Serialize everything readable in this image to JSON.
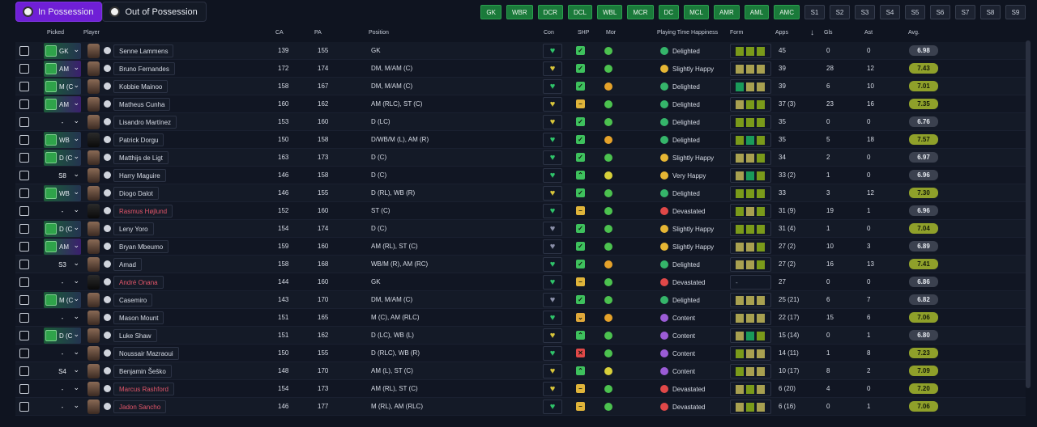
{
  "tabs": [
    {
      "label": "In Possession",
      "active": true
    },
    {
      "label": "Out of Possession",
      "active": false
    }
  ],
  "filters": [
    {
      "label": "GK",
      "active": true
    },
    {
      "label": "WBR",
      "active": true
    },
    {
      "label": "DCR",
      "active": true
    },
    {
      "label": "DCL",
      "active": true
    },
    {
      "label": "WBL",
      "active": true
    },
    {
      "label": "MCR",
      "active": true
    },
    {
      "label": "DC",
      "active": true
    },
    {
      "label": "MCL",
      "active": true
    },
    {
      "label": "AMR",
      "active": true
    },
    {
      "label": "AML",
      "active": true
    },
    {
      "label": "AMC",
      "active": true
    },
    {
      "label": "S1",
      "active": false
    },
    {
      "label": "S2",
      "active": false
    },
    {
      "label": "S3",
      "active": false
    },
    {
      "label": "S4",
      "active": false
    },
    {
      "label": "S5",
      "active": false
    },
    {
      "label": "S6",
      "active": false
    },
    {
      "label": "S7",
      "active": false
    },
    {
      "label": "S8",
      "active": false
    },
    {
      "label": "S9",
      "active": false
    }
  ],
  "columns": {
    "picked": "Picked",
    "player": "Player",
    "ca": "CA",
    "pa": "PA",
    "position": "Position",
    "con": "Con",
    "shp": "SHP",
    "mor": "Mor",
    "happiness": "Playing Time Happiness",
    "form": "Form",
    "apps": "Apps",
    "sort_arrow": "↓",
    "gls": "Gls",
    "ast": "Ast",
    "avg": "Avg."
  },
  "colors": {
    "accent": "#6f1fd6",
    "filter_green": "#1a7a3a",
    "rating_high": "#8fa02a",
    "rating_low": "#3b414f",
    "red_name": "#e2566a"
  },
  "players": [
    {
      "picked": "GK",
      "picked_style": "g",
      "name": "Senne Lammens",
      "red": false,
      "silhouette": false,
      "ca": "139",
      "pa": "155",
      "position": "GK",
      "con": "green",
      "shp": "check",
      "mor": "green",
      "happiness": "Delighted",
      "happy_color": "green",
      "form": [
        "#7a9a1a",
        "#7a9a1a",
        "#7a9a1a"
      ],
      "apps": "45",
      "gls": "0",
      "ast": "0",
      "avg": "6.98",
      "avg_high": false
    },
    {
      "picked": "AM",
      "picked_style": "p",
      "name": "Bruno Fernandes",
      "red": false,
      "silhouette": false,
      "ca": "172",
      "pa": "174",
      "position": "DM, M/AM (C)",
      "con": "yellow",
      "shp": "check",
      "mor": "green",
      "happiness": "Slightly Happy",
      "happy_color": "yellow",
      "form": [
        "#a8a050",
        "#a8a050",
        "#a8a050"
      ],
      "apps": "39",
      "gls": "28",
      "ast": "12",
      "avg": "7.43",
      "avg_high": true
    },
    {
      "picked": "M (C",
      "picked_style": "g",
      "name": "Kobbie Mainoo",
      "red": false,
      "silhouette": false,
      "ca": "158",
      "pa": "167",
      "position": "DM, M/AM (C)",
      "con": "green",
      "shp": "check",
      "mor": "orange",
      "happiness": "Delighted",
      "happy_color": "green",
      "form": [
        "#1a9a5a",
        "#a8a050",
        "#a8a050"
      ],
      "apps": "39",
      "gls": "6",
      "ast": "10",
      "avg": "7.01",
      "avg_high": true
    },
    {
      "picked": "AM",
      "picked_style": "p",
      "name": "Matheus Cunha",
      "red": false,
      "silhouette": false,
      "ca": "160",
      "pa": "162",
      "position": "AM (RLC), ST (C)",
      "con": "yellow",
      "shp": "dash",
      "mor": "green",
      "happiness": "Delighted",
      "happy_color": "green",
      "form": [
        "#a8a050",
        "#7a9a1a",
        "#7a9a1a"
      ],
      "apps": "37 (3)",
      "gls": "23",
      "ast": "16",
      "avg": "7.35",
      "avg_high": true
    },
    {
      "picked": "-",
      "picked_style": "n",
      "name": "Lisandro Martínez",
      "red": false,
      "silhouette": false,
      "ca": "153",
      "pa": "160",
      "position": "D (LC)",
      "con": "yellow",
      "shp": "check",
      "mor": "green",
      "happiness": "Delighted",
      "happy_color": "green",
      "form": [
        "#7a9a1a",
        "#7a9a1a",
        "#7a9a1a"
      ],
      "apps": "35",
      "gls": "0",
      "ast": "0",
      "avg": "6.76",
      "avg_high": false
    },
    {
      "picked": "WB",
      "picked_style": "g",
      "name": "Patrick Dorgu",
      "red": false,
      "silhouette": true,
      "ca": "150",
      "pa": "158",
      "position": "D/WB/M (L), AM (R)",
      "con": "green",
      "shp": "check",
      "mor": "orange",
      "happiness": "Delighted",
      "happy_color": "green",
      "form": [
        "#7a9a1a",
        "#1a9a5a",
        "#7a9a1a"
      ],
      "apps": "35",
      "gls": "5",
      "ast": "18",
      "avg": "7.57",
      "avg_high": true
    },
    {
      "picked": "D (C",
      "picked_style": "g",
      "name": "Matthijs de Ligt",
      "red": false,
      "silhouette": false,
      "ca": "163",
      "pa": "173",
      "position": "D (C)",
      "con": "green",
      "shp": "check",
      "mor": "green",
      "happiness": "Slightly Happy",
      "happy_color": "yellow",
      "form": [
        "#a8a050",
        "#a8a050",
        "#7a9a1a"
      ],
      "apps": "34",
      "gls": "2",
      "ast": "0",
      "avg": "6.97",
      "avg_high": false
    },
    {
      "picked": "S8",
      "picked_style": "n",
      "name": "Harry Maguire",
      "red": false,
      "silhouette": false,
      "ca": "146",
      "pa": "158",
      "position": "D (C)",
      "con": "green",
      "shp": "up",
      "mor": "yellow",
      "happiness": "Very Happy",
      "happy_color": "yellow",
      "form": [
        "#a8a050",
        "#1a9a5a",
        "#7a9a1a"
      ],
      "apps": "33 (2)",
      "gls": "1",
      "ast": "0",
      "avg": "6.96",
      "avg_high": false
    },
    {
      "picked": "WB",
      "picked_style": "g",
      "name": "Diogo Dalot",
      "red": false,
      "silhouette": false,
      "ca": "146",
      "pa": "155",
      "position": "D (RL), WB (R)",
      "con": "yellow",
      "shp": "check",
      "mor": "green",
      "happiness": "Delighted",
      "happy_color": "green",
      "form": [
        "#7a9a1a",
        "#7a9a1a",
        "#7a9a1a"
      ],
      "apps": "33",
      "gls": "3",
      "ast": "12",
      "avg": "7.30",
      "avg_high": true
    },
    {
      "picked": "-",
      "picked_style": "n",
      "name": "Rasmus Højlund",
      "red": true,
      "silhouette": true,
      "ca": "152",
      "pa": "160",
      "position": "ST (C)",
      "con": "green",
      "shp": "dash",
      "mor": "green",
      "happiness": "Devastated",
      "happy_color": "red",
      "form": [
        "#7a9a1a",
        "#a8a050",
        "#7a9a1a"
      ],
      "apps": "31 (9)",
      "gls": "19",
      "ast": "1",
      "avg": "6.96",
      "avg_high": false
    },
    {
      "picked": "D (C",
      "picked_style": "g",
      "name": "Leny Yoro",
      "red": false,
      "silhouette": false,
      "ca": "154",
      "pa": "174",
      "position": "D (C)",
      "con": "grey",
      "shp": "check",
      "mor": "green",
      "happiness": "Slightly Happy",
      "happy_color": "yellow",
      "form": [
        "#7a9a1a",
        "#7a9a1a",
        "#7a9a1a"
      ],
      "apps": "31 (4)",
      "gls": "1",
      "ast": "0",
      "avg": "7.04",
      "avg_high": true
    },
    {
      "picked": "AM",
      "picked_style": "p",
      "name": "Bryan Mbeumo",
      "red": false,
      "silhouette": false,
      "ca": "159",
      "pa": "160",
      "position": "AM (RL), ST (C)",
      "con": "grey",
      "shp": "check",
      "mor": "green",
      "happiness": "Slightly Happy",
      "happy_color": "yellow",
      "form": [
        "#a8a050",
        "#a8a050",
        "#7a9a1a"
      ],
      "apps": "27 (2)",
      "gls": "10",
      "ast": "3",
      "avg": "6.89",
      "avg_high": false
    },
    {
      "picked": "S3",
      "picked_style": "n",
      "name": "Amad",
      "red": false,
      "silhouette": false,
      "ca": "158",
      "pa": "168",
      "position": "WB/M (R), AM (RC)",
      "con": "green",
      "shp": "check",
      "mor": "orange",
      "happiness": "Delighted",
      "happy_color": "green",
      "form": [
        "#a8a050",
        "#a8a050",
        "#7a9a1a"
      ],
      "apps": "27 (2)",
      "gls": "16",
      "ast": "13",
      "avg": "7.41",
      "avg_high": true
    },
    {
      "picked": "-",
      "picked_style": "n",
      "name": "André Onana",
      "red": true,
      "silhouette": true,
      "ca": "144",
      "pa": "160",
      "position": "GK",
      "con": "green",
      "shp": "dash",
      "mor": "green",
      "happiness": "Devastated",
      "happy_color": "red",
      "form": [],
      "apps": "27",
      "gls": "0",
      "ast": "0",
      "avg": "6.86",
      "avg_high": false
    },
    {
      "picked": "M (C",
      "picked_style": "g",
      "name": "Casemiro",
      "red": false,
      "silhouette": false,
      "ca": "143",
      "pa": "170",
      "position": "DM, M/AM (C)",
      "con": "grey",
      "shp": "check",
      "mor": "green",
      "happiness": "Delighted",
      "happy_color": "green",
      "form": [
        "#a8a050",
        "#a8a050",
        "#a8a050"
      ],
      "apps": "25 (21)",
      "gls": "6",
      "ast": "7",
      "avg": "6.82",
      "avg_high": false
    },
    {
      "picked": "-",
      "picked_style": "n",
      "name": "Mason Mount",
      "red": false,
      "silhouette": false,
      "ca": "151",
      "pa": "165",
      "position": "M (C), AM (RLC)",
      "con": "green",
      "shp": "down",
      "mor": "orange",
      "happiness": "Content",
      "happy_color": "purple",
      "form": [
        "#a8a050",
        "#a8a050",
        "#a8a050"
      ],
      "apps": "22 (17)",
      "gls": "15",
      "ast": "6",
      "avg": "7.06",
      "avg_high": true
    },
    {
      "picked": "D (C",
      "picked_style": "g",
      "name": "Luke Shaw",
      "red": false,
      "silhouette": false,
      "ca": "151",
      "pa": "162",
      "position": "D (LC), WB (L)",
      "con": "yellow",
      "shp": "up",
      "mor": "green",
      "happiness": "Content",
      "happy_color": "purple",
      "form": [
        "#a8a050",
        "#1a9a5a",
        "#7a9a1a"
      ],
      "apps": "15 (14)",
      "gls": "0",
      "ast": "1",
      "avg": "6.80",
      "avg_high": false
    },
    {
      "picked": "-",
      "picked_style": "n",
      "name": "Noussair Mazraoui",
      "red": false,
      "silhouette": false,
      "ca": "150",
      "pa": "155",
      "position": "D (RLC), WB (R)",
      "con": "green",
      "shp": "cross",
      "mor": "green",
      "happiness": "Content",
      "happy_color": "purple",
      "form": [
        "#7a9a1a",
        "#a8a050",
        "#a8a050"
      ],
      "apps": "14 (11)",
      "gls": "1",
      "ast": "8",
      "avg": "7.23",
      "avg_high": true
    },
    {
      "picked": "S4",
      "picked_style": "n",
      "name": "Benjamin Šeško",
      "red": false,
      "silhouette": false,
      "ca": "148",
      "pa": "170",
      "position": "AM (L), ST (C)",
      "con": "yellow",
      "shp": "up",
      "mor": "yellow",
      "happiness": "Content",
      "happy_color": "purple",
      "form": [
        "#7a9a1a",
        "#a8a050",
        "#a8a050"
      ],
      "apps": "10 (17)",
      "gls": "8",
      "ast": "2",
      "avg": "7.09",
      "avg_high": true
    },
    {
      "picked": "-",
      "picked_style": "n",
      "name": "Marcus Rashford",
      "red": true,
      "silhouette": false,
      "ca": "154",
      "pa": "173",
      "position": "AM (RL), ST (C)",
      "con": "yellow",
      "shp": "dash",
      "mor": "green",
      "happiness": "Devastated",
      "happy_color": "red",
      "form": [
        "#a8a050",
        "#7a9a1a",
        "#a8a050"
      ],
      "apps": "6 (20)",
      "gls": "4",
      "ast": "0",
      "avg": "7.20",
      "avg_high": true
    },
    {
      "picked": "-",
      "picked_style": "n",
      "name": "Jadon Sancho",
      "red": true,
      "silhouette": false,
      "ca": "146",
      "pa": "177",
      "position": "M (RL), AM (RLC)",
      "con": "green",
      "shp": "dash",
      "mor": "green",
      "happiness": "Devastated",
      "happy_color": "red",
      "form": [
        "#a8a050",
        "#7a9a1a",
        "#a8a050"
      ],
      "apps": "6 (16)",
      "gls": "0",
      "ast": "1",
      "avg": "7.06",
      "avg_high": true
    }
  ]
}
